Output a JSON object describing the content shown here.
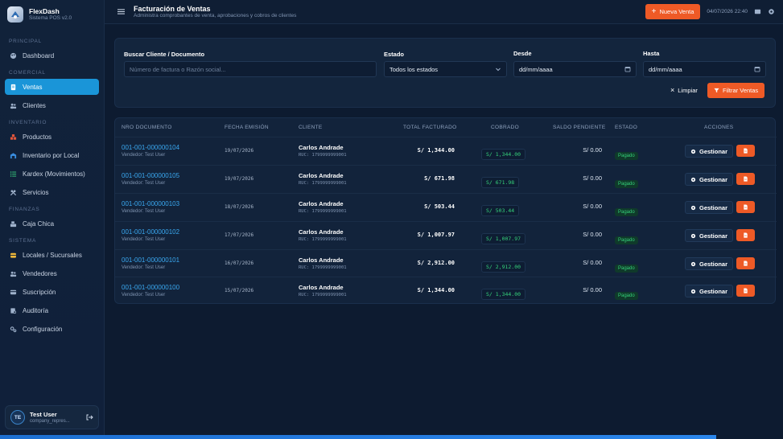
{
  "brand": {
    "name": "FlexDash",
    "version": "Sistema POS v2.0"
  },
  "sidebar": {
    "sections": {
      "principal": "PRINCIPAL",
      "comercial": "COMERCIAL",
      "inventario": "INVENTARIO",
      "finanzas": "FINANZAS",
      "sistema": "SISTEMA"
    },
    "items": {
      "dashboard": "Dashboard",
      "ventas": "Ventas",
      "clientes": "Clientes",
      "productos": "Productos",
      "inventario_local": "Inventario por Local",
      "kardex": "Kardex (Movimientos)",
      "servicios": "Servicios",
      "caja_chica": "Caja Chica",
      "locales": "Locales / Sucursales",
      "vendedores": "Vendedores",
      "suscripcion": "Suscripción",
      "auditoria": "Auditoría",
      "configuracion": "Configuración"
    },
    "active": "ventas"
  },
  "user": {
    "initials": "TE",
    "name": "Test User",
    "company": "company_repres..."
  },
  "header": {
    "title": "Facturación de Ventas",
    "subtitle": "Administra comprobantes de venta, aprobaciones y cobros de clientes",
    "new_sale_label": "Nueva Venta",
    "datetime": "04/07/2026 22:40"
  },
  "filters": {
    "search_label": "Buscar Cliente / Documento",
    "search_placeholder": "Número de factura o Razón social...",
    "status_label": "Estado",
    "status_value": "Todos los estados",
    "from_label": "Desde",
    "from_value": "dd/mm/aaaa",
    "to_label": "Hasta",
    "to_value": "dd/mm/aaaa",
    "clear_label": "Limpiar",
    "filter_label": "Filtrar Ventas"
  },
  "table": {
    "headers": {
      "doc": "NRO DOCUMENTO",
      "date": "FECHA EMISIÓN",
      "client": "CLIENTE",
      "total": "TOTAL FACTURADO",
      "paid": "COBRADO",
      "pending": "SALDO PENDIENTE",
      "status": "ESTADO",
      "actions": "ACCIONES"
    },
    "manage_label": "Gestionar",
    "rows": [
      {
        "doc": "001-001-000000104",
        "seller": "Vendedor: Test User",
        "date": "19/07/2026",
        "client": "Carlos Andrade",
        "ruc": "RUC: 1799999999001",
        "total": "S/ 1,344.00",
        "paid": "S/ 1,344.00",
        "pending": "S/ 0.00",
        "status": "Pagado"
      },
      {
        "doc": "001-001-000000105",
        "seller": "Vendedor: Test User",
        "date": "19/07/2026",
        "client": "Carlos Andrade",
        "ruc": "RUC: 1799999999001",
        "total": "S/ 671.98",
        "paid": "S/ 671.98",
        "pending": "S/ 0.00",
        "status": "Pagado"
      },
      {
        "doc": "001-001-000000103",
        "seller": "Vendedor: Test User",
        "date": "18/07/2026",
        "client": "Carlos Andrade",
        "ruc": "RUC: 1799999999001",
        "total": "S/ 503.44",
        "paid": "S/ 503.44",
        "pending": "S/ 0.00",
        "status": "Pagado"
      },
      {
        "doc": "001-001-000000102",
        "seller": "Vendedor: Test User",
        "date": "17/07/2026",
        "client": "Carlos Andrade",
        "ruc": "RUC: 1799999999001",
        "total": "S/ 1,007.97",
        "paid": "S/ 1,007.97",
        "pending": "S/ 0.00",
        "status": "Pagado"
      },
      {
        "doc": "001-001-000000101",
        "seller": "Vendedor: Test User",
        "date": "16/07/2026",
        "client": "Carlos Andrade",
        "ruc": "RUC: 1799999999001",
        "total": "S/ 2,912.00",
        "paid": "S/ 2,912.00",
        "pending": "S/ 0.00",
        "status": "Pagado"
      },
      {
        "doc": "001-001-000000100",
        "seller": "Vendedor: Test User",
        "date": "15/07/2026",
        "client": "Carlos Andrade",
        "ruc": "RUC: 1799999999001",
        "total": "S/ 1,344.00",
        "paid": "S/ 1,344.00",
        "pending": "S/ 0.00",
        "status": "Pagado"
      }
    ]
  },
  "colors": {
    "accent": "#1a95d8",
    "primary_action": "#ee5a26",
    "paid_green": "#35d07a",
    "background": "#0d1b30"
  },
  "icons": {
    "dashboard": "palette-icon",
    "ventas": "receipt-icon",
    "clientes": "users-icon",
    "productos": "boxes-icon",
    "inventario_local": "warehouse-icon",
    "kardex": "list-icon",
    "servicios": "tools-icon",
    "caja_chica": "cash-register-icon",
    "locales": "building-icon",
    "vendedores": "team-icon",
    "suscripcion": "card-icon",
    "auditoria": "audit-icon",
    "configuracion": "gears-icon"
  }
}
